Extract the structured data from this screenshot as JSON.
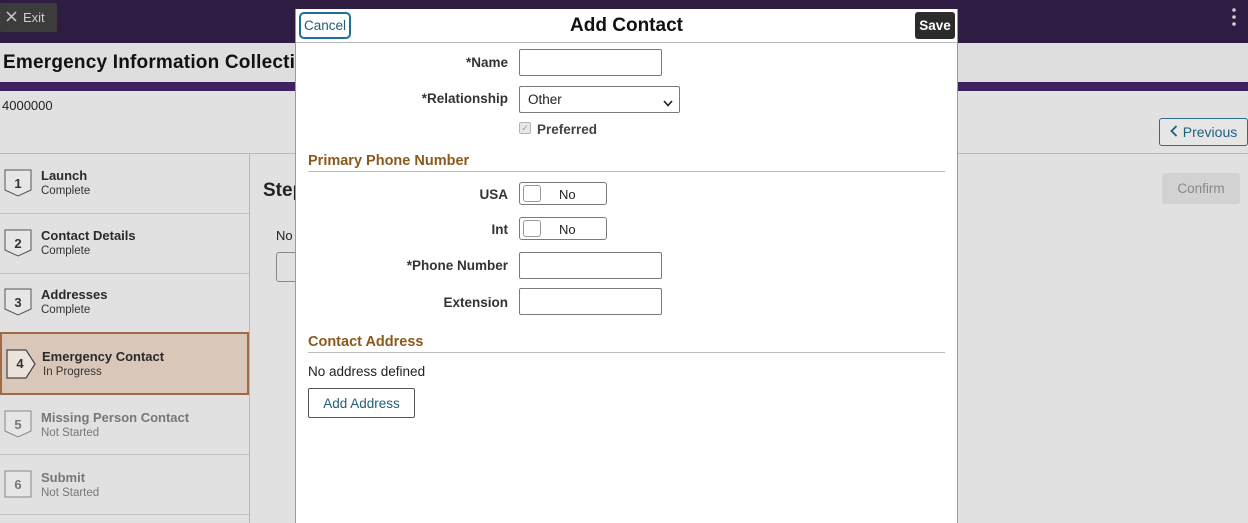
{
  "topbar": {
    "exit_label": "Exit"
  },
  "app": {
    "title": "Emergency Information Collection",
    "id_number": "4000000"
  },
  "nav": {
    "previous_label": "Previous",
    "confirm_label": "Confirm"
  },
  "main": {
    "step_heading": "Step",
    "no_text": "No"
  },
  "steps": [
    {
      "num": "1",
      "title": "Launch",
      "status": "Complete"
    },
    {
      "num": "2",
      "title": "Contact Details",
      "status": "Complete"
    },
    {
      "num": "3",
      "title": "Addresses",
      "status": "Complete"
    },
    {
      "num": "4",
      "title": "Emergency Contact",
      "status": "In Progress"
    },
    {
      "num": "5",
      "title": "Missing Person Contact",
      "status": "Not Started"
    },
    {
      "num": "6",
      "title": "Submit",
      "status": "Not Started"
    }
  ],
  "modal": {
    "cancel_label": "Cancel",
    "title": "Add Contact",
    "save_label": "Save",
    "name_label": "*Name",
    "name_value": "",
    "relationship_label": "*Relationship",
    "relationship_value": "Other",
    "preferred_label": "Preferred",
    "preferred_checked": true,
    "primary_phone_section": "Primary Phone Number",
    "usa_label": "USA",
    "usa_value": "No",
    "int_label": "Int",
    "int_value": "No",
    "phone_label": "*Phone Number",
    "phone_value": "",
    "extension_label": "Extension",
    "extension_value": "",
    "address_section": "Contact Address",
    "no_address_text": "No address defined",
    "add_address_label": "Add Address"
  },
  "colors": {
    "header_purple": "#2f1c43",
    "stripe_purple": "#3d2260",
    "section_brown": "#8a5a1c",
    "link_blue": "#1f5f7a",
    "active_step_bg": "#d9c7ba"
  }
}
